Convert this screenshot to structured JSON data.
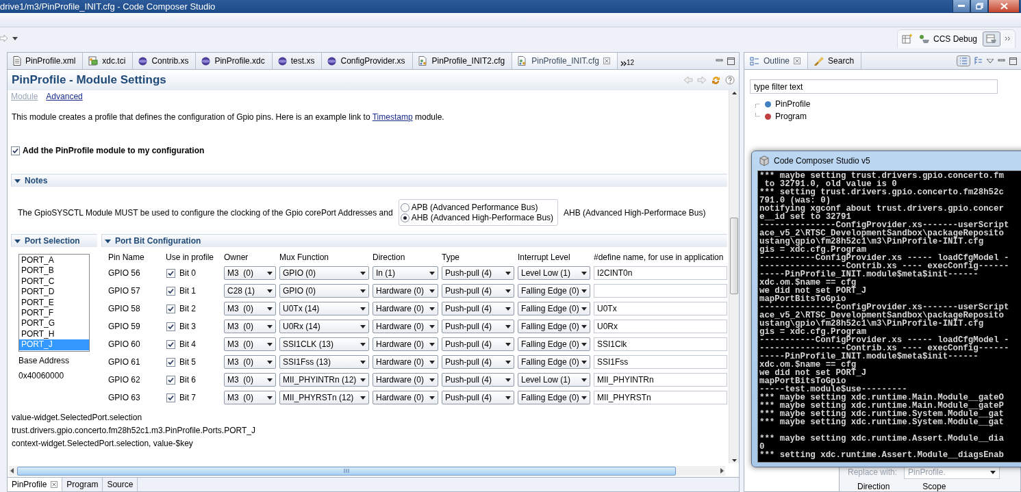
{
  "window": {
    "title": "drive1/m3/PinProfile_INIT.cfg - Code Composer Studio"
  },
  "perspective": {
    "label": "CCS Debug"
  },
  "editor_tabs": [
    {
      "label": "PinProfile.xml",
      "kind": "file",
      "selected": false
    },
    {
      "label": "xdc.tci",
      "kind": "tci",
      "selected": false
    },
    {
      "label": "Contrib.xs",
      "kind": "script",
      "selected": false
    },
    {
      "label": "PinProfile.xdc",
      "kind": "script",
      "selected": false
    },
    {
      "label": "test.xs",
      "kind": "script",
      "selected": false
    },
    {
      "label": "ConfigProvider.xs",
      "kind": "script",
      "selected": false
    },
    {
      "label": "PinProfile_INIT2.cfg",
      "kind": "config",
      "selected": false
    },
    {
      "label": "PinProfile_INIT.cfg",
      "kind": "config",
      "selected": true
    }
  ],
  "editor_tabs_overflow": "12",
  "form": {
    "title": "PinProfile - Module Settings",
    "nav": [
      {
        "label": "Module",
        "selected": true
      },
      {
        "label": "Advanced",
        "selected": false
      }
    ],
    "description": {
      "before": "This module creates a profile that defines the configuration of Gpio pins. Here is an example link to ",
      "link": "Timestamp",
      "after": " module."
    },
    "add_module": {
      "label": "Add the PinProfile module to my configuration",
      "checked": true
    },
    "notes": {
      "title": "Notes",
      "expanded": true,
      "text": "The GpioSYSCTL Module MUST be used to configure the clocking of the Gpio corePort Addresses and",
      "radios": [
        {
          "label": "APB (Advanced Performance Bus)",
          "selected": false
        },
        {
          "label": "AHB (Advanced High-Performace Bus)",
          "selected": true
        }
      ],
      "value": "AHB (Advanced High-Performace Bus)"
    },
    "port_selection": {
      "title": "Port Selection",
      "expanded": true,
      "ports": [
        {
          "label": "PORT_A",
          "selected": false
        },
        {
          "label": "PORT_B",
          "selected": false
        },
        {
          "label": "PORT_C",
          "selected": false
        },
        {
          "label": "PORT_D",
          "selected": false
        },
        {
          "label": "PORT_E",
          "selected": false
        },
        {
          "label": "PORT_F",
          "selected": false
        },
        {
          "label": "PORT_G",
          "selected": false
        },
        {
          "label": "PORT_H",
          "selected": false
        },
        {
          "label": "PORT_J",
          "selected": true
        }
      ],
      "base_address_label": "Base Address",
      "base_address": "0x40060000"
    },
    "port_bits": {
      "title": "Port Bit Configuration",
      "expanded": true,
      "columns": [
        "Pin Name",
        "Use in profile",
        "Owner",
        "Mux Function",
        "Direction",
        "Type",
        "Interrupt Level",
        "#define name, for use in application"
      ],
      "rows": [
        {
          "pin": "GPIO 56",
          "use": {
            "label": "Bit 0",
            "checked": true
          },
          "owner": "M3  (0)",
          "mux": "GPIO (0)",
          "direction": "In (1)",
          "type": "Push-pull (4)",
          "interrupt": "Level Low (1)",
          "define": "I2CINT0n"
        },
        {
          "pin": "GPIO 57",
          "use": {
            "label": "Bit 1",
            "checked": true
          },
          "owner": "C28 (1)",
          "mux": "GPIO (0)",
          "direction": "Hardware (0)",
          "type": "Push-pull (4)",
          "interrupt": "Falling Edge (0)"
        },
        {
          "pin": "GPIO 58",
          "use": {
            "label": "Bit 2",
            "checked": true
          },
          "owner": "M3  (0)",
          "mux": "U0Tx (14)",
          "direction": "Hardware (0)",
          "type": "Push-pull (4)",
          "interrupt": "Falling Edge (0)",
          "define": "U0Tx"
        },
        {
          "pin": "GPIO 59",
          "use": {
            "label": "Bit 3",
            "checked": true
          },
          "owner": "M3  (0)",
          "mux": "U0Rx (14)",
          "direction": "Hardware (0)",
          "type": "Push-pull (4)",
          "interrupt": "Falling Edge (0)",
          "define": "U0Rx"
        },
        {
          "pin": "GPIO 60",
          "use": {
            "label": "Bit 4",
            "checked": true
          },
          "owner": "M3  (0)",
          "mux": "SSI1CLK (13)",
          "direction": "Hardware (0)",
          "type": "Push-pull (4)",
          "interrupt": "Falling Edge (0)",
          "define": "SSI1Clk"
        },
        {
          "pin": "GPIO 61",
          "use": {
            "label": "Bit 5",
            "checked": true
          },
          "owner": "M3  (0)",
          "mux": "SSI1Fss (13)",
          "direction": "Hardware (0)",
          "type": "Push-pull (4)",
          "interrupt": "Falling Edge (0)",
          "define": "SSI1Fss"
        },
        {
          "pin": "GPIO 62",
          "use": {
            "label": "Bit 6",
            "checked": true
          },
          "owner": "M3  (0)",
          "mux": "MII_PHYINTRn (12)",
          "direction": "Hardware (0)",
          "type": "Push-pull (4)",
          "interrupt": "Level Low (1)",
          "define": "MII_PHYINTRn"
        },
        {
          "pin": "GPIO 63",
          "use": {
            "label": "Bit 7",
            "checked": true
          },
          "owner": "M3  (0)",
          "mux": "MII_PHYRSTn (12)",
          "direction": "Hardware (0)",
          "type": "Push-pull (4)",
          "interrupt": "Falling Edge (0)",
          "define": "MII_PHYRSTn"
        }
      ]
    },
    "footer_lines": [
      "value-widget.SelectedPort.selection",
      "trust.drivers.gpio.concerto.fm28h52c1.m3.PinProfile.Ports.PORT_J",
      "context-widget.SelectedPort.selection, value-$key"
    ]
  },
  "bottom_tabs": [
    {
      "label": "PinProfile",
      "selected": true
    },
    {
      "label": "Program",
      "selected": false
    },
    {
      "label": "Source",
      "selected": false
    }
  ],
  "outline": {
    "tabs": [
      {
        "label": "Outline",
        "selected": true
      },
      {
        "label": "Search",
        "selected": false
      }
    ],
    "filter": {
      "placeholder": "type filter text"
    },
    "items": [
      {
        "label": "PinProfile",
        "color": "#3f7fc0"
      },
      {
        "label": "Program",
        "color": "#c03f3f"
      }
    ],
    "replace": {
      "label": "Replace with:",
      "value": "PinProfile."
    },
    "columns": [
      "Direction",
      "Scope"
    ]
  },
  "console": {
    "title": "Code Composer Studio v5",
    "lines": [
      "*** maybe setting trust.drivers.gpio.concerto.fm",
      " to 32791.0, old value is 0",
      "*** setting trust.drivers.gpio.concerto.fm28h52c",
      "791.0 (was: 0)",
      "notifying xgconf about trust.drivers.gpio.concer",
      "e__id set to 32791",
      "---------------ConfigProvider.xs-------userScript",
      "ace_v5_2\\RTSC_DevelopmentSandbox\\packageReposito",
      "ustang\\gpio\\fm28h52c1\\m3\\PinProfile-INIT.cfg",
      "gis = xdc.cfg.Program",
      "-----------ConfigProvider.xs ----- loadCfgModel -",
      "-----------------Contrib.xs ---- execConfig------",
      "-----PinProfile_INIT.module$meta$init------",
      "xdc.om.$name == cfg",
      "we did not set PORT_J",
      "mapPortBitsToGpio",
      "---------------ConfigProvider.xs-------userScript",
      "ace_v5_2\\RTSC_DevelopmentSandbox\\packageReposito",
      "ustang\\gpio\\fm28h52c1\\m3\\PinProfile-INIT.cfg",
      "gis = xdc.cfg.Program",
      "-----------ConfigProvider.xs ----- loadCfgModel -",
      "-----------------Contrib.xs ---- execConfig------",
      "-----PinProfile_INIT.module$meta$init------",
      "xdc.om.$name == cfg",
      "we did not set PORT_J",
      "mapPortBitsToGpio",
      "-----test.module$use---------",
      "*** maybe setting xdc.runtime.Main.Module__gateO",
      "*** maybe setting xdc.runtime.Main.Module__gateP",
      "*** maybe setting xdc.runtime.System.Module__gat",
      "*** maybe setting xdc.runtime.System.Module__gat",
      "*** maybe setting xdc.runtime.Assert.Module__dia",
      "0",
      "*** setting xdc.runtime.Assert.Module__diagsEnab"
    ]
  }
}
